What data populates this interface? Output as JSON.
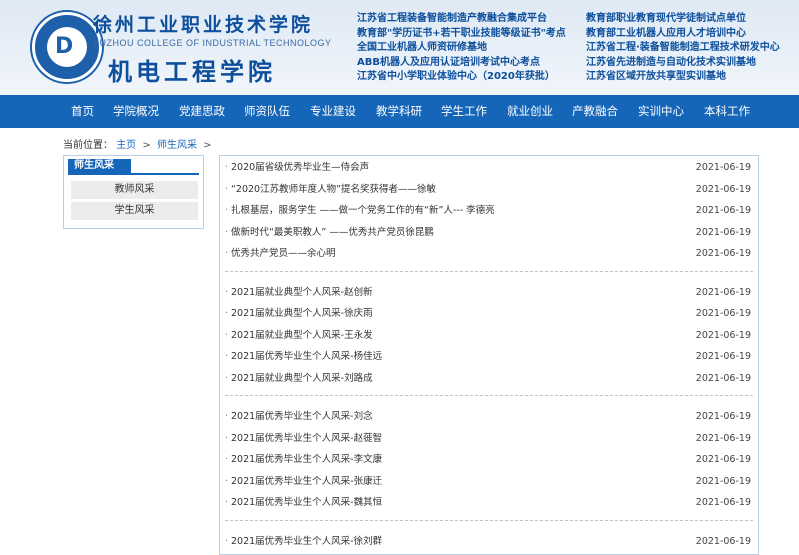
{
  "header": {
    "school_name_cn": "徐州工业职业技术学院",
    "school_name_en": "XUZHOU COLLEGE OF INDUSTRIAL TECHNOLOGY",
    "department": "机电工程学院",
    "logo_icon": "college-seal-icon",
    "logo_mark": "D",
    "honors_left": [
      "江苏省工程装备智能制造产教融合集成平台",
      "教育部\"学历证书+若干职业技能等级证书\"考点",
      "全国工业机器人师资研修基地",
      "ABB机器人及应用认证培训考试中心考点",
      "江苏省中小学职业体验中心（2020年获批）"
    ],
    "honors_right": [
      "教育部职业教育现代学徒制试点单位",
      "教育部工业机器人应用人才培训中心",
      "江苏省工程·装备智能制造工程技术研发中心",
      "江苏省先进制造与自动化技术实训基地",
      "江苏省区域开放共享型实训基地"
    ]
  },
  "nav": {
    "items": [
      "首页",
      "学院概况",
      "党建思政",
      "师资队伍",
      "专业建设",
      "教学科研",
      "学生工作",
      "就业创业",
      "产教融合",
      "实训中心",
      "本科工作"
    ]
  },
  "breadcrumb": {
    "prefix": "当前位置：",
    "home": "主页",
    "current": "师生风采",
    "separator": ">"
  },
  "sidebar": {
    "title": "师生风采",
    "items": [
      "教师风采",
      "学生风采"
    ]
  },
  "list": {
    "groups": [
      [
        {
          "title": "2020届省级优秀毕业生—侍会声",
          "date": "2021-06-19"
        },
        {
          "title": "“2020江苏教师年度人物”提名奖获得者——徐敏",
          "date": "2021-06-19"
        },
        {
          "title": "扎根基层，服务学生 ——做一个党务工作的有“新”人--- 李德亮",
          "date": "2021-06-19"
        },
        {
          "title": "做新时代“最美职教人” ——优秀共产党员徐昆鹏",
          "date": "2021-06-19"
        },
        {
          "title": "优秀共产党员——余心明",
          "date": "2021-06-19"
        }
      ],
      [
        {
          "title": "2021届就业典型个人风采-赵创新",
          "date": "2021-06-19"
        },
        {
          "title": "2021届就业典型个人风采-徐庆雨",
          "date": "2021-06-19"
        },
        {
          "title": "2021届就业典型个人风采-王永发",
          "date": "2021-06-19"
        },
        {
          "title": "2021届优秀毕业生个人风采-杨佳远",
          "date": "2021-06-19"
        },
        {
          "title": "2021届就业典型个人风采-刘路成",
          "date": "2021-06-19"
        }
      ],
      [
        {
          "title": "2021届优秀毕业生个人风采-刘念",
          "date": "2021-06-19"
        },
        {
          "title": "2021届优秀毕业生个人风采-赵蓰智",
          "date": "2021-06-19"
        },
        {
          "title": "2021届优秀毕业生个人风采-李文康",
          "date": "2021-06-19"
        },
        {
          "title": "2021届优秀毕业生个人风采-张康迁",
          "date": "2021-06-19"
        },
        {
          "title": "2021届优秀毕业生个人风采-魏其恒",
          "date": "2021-06-19"
        }
      ],
      [
        {
          "title": "2021届优秀毕业生个人风采-徐刘群",
          "date": "2021-06-19"
        }
      ]
    ],
    "bullet": "·"
  },
  "colors": {
    "brand_blue": "#1565b9",
    "header_text": "#0d4f9c",
    "header_bg": "#e6eef7"
  }
}
